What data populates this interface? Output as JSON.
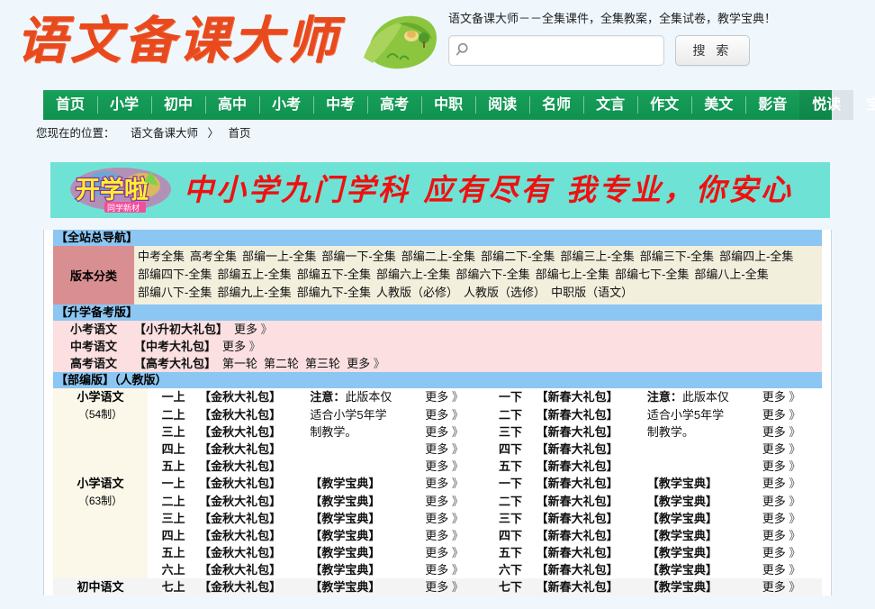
{
  "site": {
    "logo_text": "语文备课大师",
    "tagline": "语文备课大师－－全集课件，全集教案，全集试卷，教学宝典！"
  },
  "search": {
    "value": "",
    "placeholder": "",
    "button_label": "搜 索",
    "icon": "search-icon"
  },
  "nav": {
    "items": [
      {
        "label": "首页",
        "active": false
      },
      {
        "label": "小学",
        "active": false
      },
      {
        "label": "初中",
        "active": false
      },
      {
        "label": "高中",
        "active": false
      },
      {
        "label": "小考",
        "active": false
      },
      {
        "label": "中考",
        "active": false
      },
      {
        "label": "高考",
        "active": false
      },
      {
        "label": "中职",
        "active": false
      },
      {
        "label": "阅读",
        "active": false
      },
      {
        "label": "名师",
        "active": false
      },
      {
        "label": "文言",
        "active": false
      },
      {
        "label": "作文",
        "active": false
      },
      {
        "label": "美文",
        "active": false
      },
      {
        "label": "影音",
        "active": false
      },
      {
        "label": "悦读",
        "active": true
      },
      {
        "label": "宝典",
        "active": false
      }
    ]
  },
  "breadcrumb": {
    "prefix": "您现在的位置：",
    "root": "语文备课大师",
    "sep": "〉",
    "current": "首页"
  },
  "banner": {
    "badge_main": "开学啦",
    "badge_sub": "同学新材",
    "text": "中小学九门学科 应有尽有  我专业，你安心"
  },
  "sections": {
    "nav_all": {
      "title": "【全站总导航】",
      "label": "版本分类",
      "links": [
        "中考全集",
        "高考全集",
        "部编一上-全集",
        "部编一下-全集",
        "部编二上-全集",
        "部编二下-全集",
        "部编三上-全集",
        "部编三下-全集",
        "部编四上-全集",
        "部编四下-全集",
        "部编五上-全集",
        "部编五下-全集",
        "部编六上-全集",
        "部编六下-全集",
        "部编七上-全集",
        "部编七下-全集",
        "部编八上-全集",
        "部编八下-全集",
        "部编九上-全集",
        "部编九下-全集",
        "人教版（必修）",
        "人教版（选修）",
        "中职版（语文）"
      ]
    },
    "prep": {
      "title": "【升学备考版】",
      "rows": [
        {
          "label": "小考语文",
          "gift": "【小升初大礼包】",
          "links": [],
          "more": "更多",
          "chev": "》"
        },
        {
          "label": "中考语文",
          "gift": "【中考大礼包】",
          "links": [],
          "more": "更多",
          "chev": "》"
        },
        {
          "label": "高考语文",
          "gift": "【高考大礼包】",
          "links": [
            "第一轮",
            "第二轮",
            "第三轮"
          ],
          "more": "更多",
          "chev": "》"
        }
      ]
    },
    "bubian": {
      "title": "【部编版】（人教版）",
      "more": "更多",
      "chev": "》",
      "groups": [
        {
          "label": "小学语文",
          "sub": "（54制）",
          "note_lines": [
            "注意：此版本仅",
            "适合小学5年学",
            "制教学。"
          ],
          "note_bold_first": true,
          "has_baodian": false,
          "rows": [
            {
              "left_term": "一上",
              "left_gift": "【金秋大礼包】",
              "right_term": "一下",
              "right_gift": "【新春大礼包】"
            },
            {
              "left_term": "二上",
              "left_gift": "【金秋大礼包】",
              "right_term": "二下",
              "right_gift": "【新春大礼包】"
            },
            {
              "left_term": "三上",
              "left_gift": "【金秋大礼包】",
              "right_term": "三下",
              "right_gift": "【新春大礼包】"
            },
            {
              "left_term": "四上",
              "left_gift": "【金秋大礼包】",
              "right_term": "四下",
              "right_gift": "【新春大礼包】"
            },
            {
              "left_term": "五上",
              "left_gift": "【金秋大礼包】",
              "right_term": "五下",
              "right_gift": "【新春大礼包】"
            }
          ]
        },
        {
          "label": "小学语文",
          "sub": "（63制）",
          "note_lines": [],
          "note_bold_first": false,
          "has_baodian": true,
          "baodian": "【教学宝典】",
          "rows": [
            {
              "left_term": "一上",
              "left_gift": "【金秋大礼包】",
              "right_term": "一下",
              "right_gift": "【新春大礼包】"
            },
            {
              "left_term": "二上",
              "left_gift": "【金秋大礼包】",
              "right_term": "二下",
              "right_gift": "【新春大礼包】"
            },
            {
              "left_term": "三上",
              "left_gift": "【金秋大礼包】",
              "right_term": "三下",
              "right_gift": "【新春大礼包】"
            },
            {
              "left_term": "四上",
              "left_gift": "【金秋大礼包】",
              "right_term": "四下",
              "right_gift": "【新春大礼包】"
            },
            {
              "left_term": "五上",
              "left_gift": "【金秋大礼包】",
              "right_term": "五下",
              "right_gift": "【新春大礼包】"
            },
            {
              "left_term": "六上",
              "left_gift": "【金秋大礼包】",
              "right_term": "六下",
              "right_gift": "【新春大礼包】"
            }
          ]
        },
        {
          "label": "初中语文",
          "sub": "",
          "note_lines": [],
          "note_bold_first": false,
          "has_baodian": true,
          "baodian": "【教学宝典】",
          "alt": true,
          "rows": [
            {
              "left_term": "七上",
              "left_gift": "【金秋大礼包】",
              "right_term": "七下",
              "right_gift": "【新春大礼包】"
            }
          ]
        }
      ]
    }
  }
}
